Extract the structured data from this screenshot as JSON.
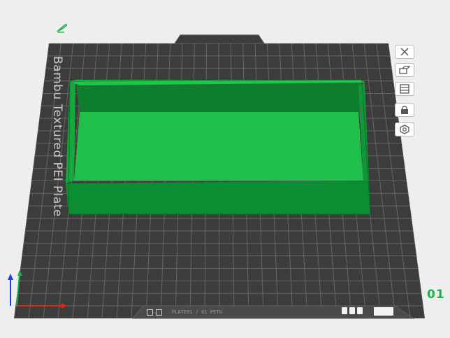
{
  "plate": {
    "label": "Bambu Textured PEI Plate",
    "number": "01",
    "file_name": "PLATE01 / 01 PETG"
  },
  "toolbar": {
    "items": [
      {
        "name": "close",
        "icon": "close-x-icon"
      },
      {
        "name": "orient",
        "icon": "orient-icon"
      },
      {
        "name": "arrange",
        "icon": "arrange-icon"
      },
      {
        "name": "lock",
        "icon": "lock-icon"
      },
      {
        "name": "settings",
        "icon": "gear-icon"
      }
    ]
  },
  "colors": {
    "background": "#eeeeef",
    "plate": "#3c3c3c",
    "grid": "#6a6a6a",
    "object_front": "#0b8d33",
    "object_inner": "#1fbf4a",
    "object_top": "#14a93d",
    "accent": "#16b34a",
    "axis_x": "#e0261f",
    "axis_y": "#16b34a",
    "axis_z": "#1f3fe0"
  }
}
